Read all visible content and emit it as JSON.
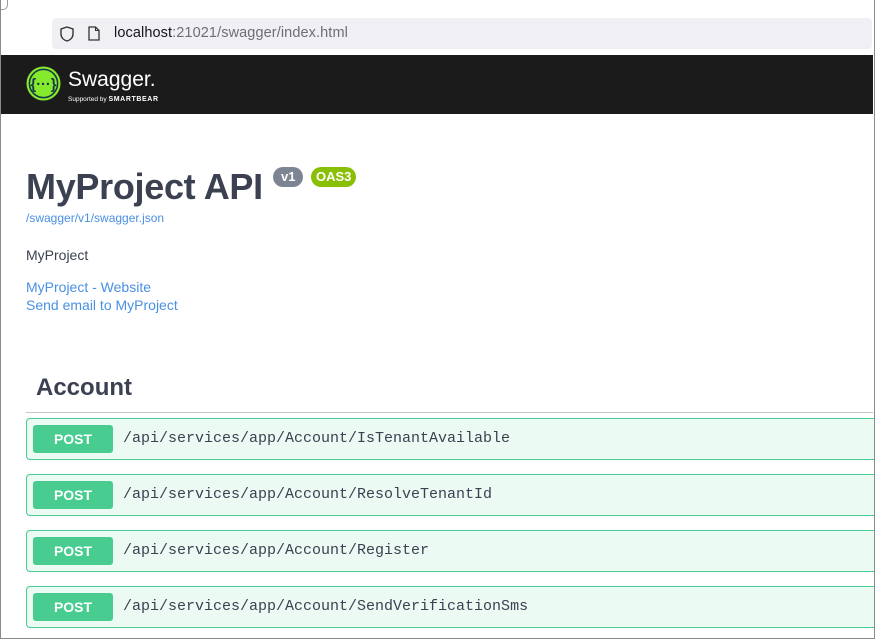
{
  "browser": {
    "url_host": "localhost",
    "url_rest": ":21021/swagger/index.html"
  },
  "topbar": {
    "brand": "Swagger",
    "brand_mark": ".",
    "supported_by": "Supported by",
    "company": "SMARTBEAR",
    "accent_color": "#85ea2d",
    "background_color": "#1b1b1b"
  },
  "info": {
    "title": "MyProject API",
    "version_badge": "v1",
    "oas_badge": "OAS3",
    "spec_url": "/swagger/v1/swagger.json",
    "description": "MyProject",
    "website_link": "MyProject - Website",
    "email_link": "Send email to MyProject"
  },
  "tag": {
    "name": "Account"
  },
  "operations": [
    {
      "method": "POST",
      "path": "/api/services/app/Account/IsTenantAvailable"
    },
    {
      "method": "POST",
      "path": "/api/services/app/Account/ResolveTenantId"
    },
    {
      "method": "POST",
      "path": "/api/services/app/Account/Register"
    },
    {
      "method": "POST",
      "path": "/api/services/app/Account/SendVerificationSms"
    }
  ],
  "colors": {
    "post": "#49cc90",
    "link": "#4990e2",
    "version_badge": "#7d8492",
    "oas_badge": "#89bf04"
  }
}
